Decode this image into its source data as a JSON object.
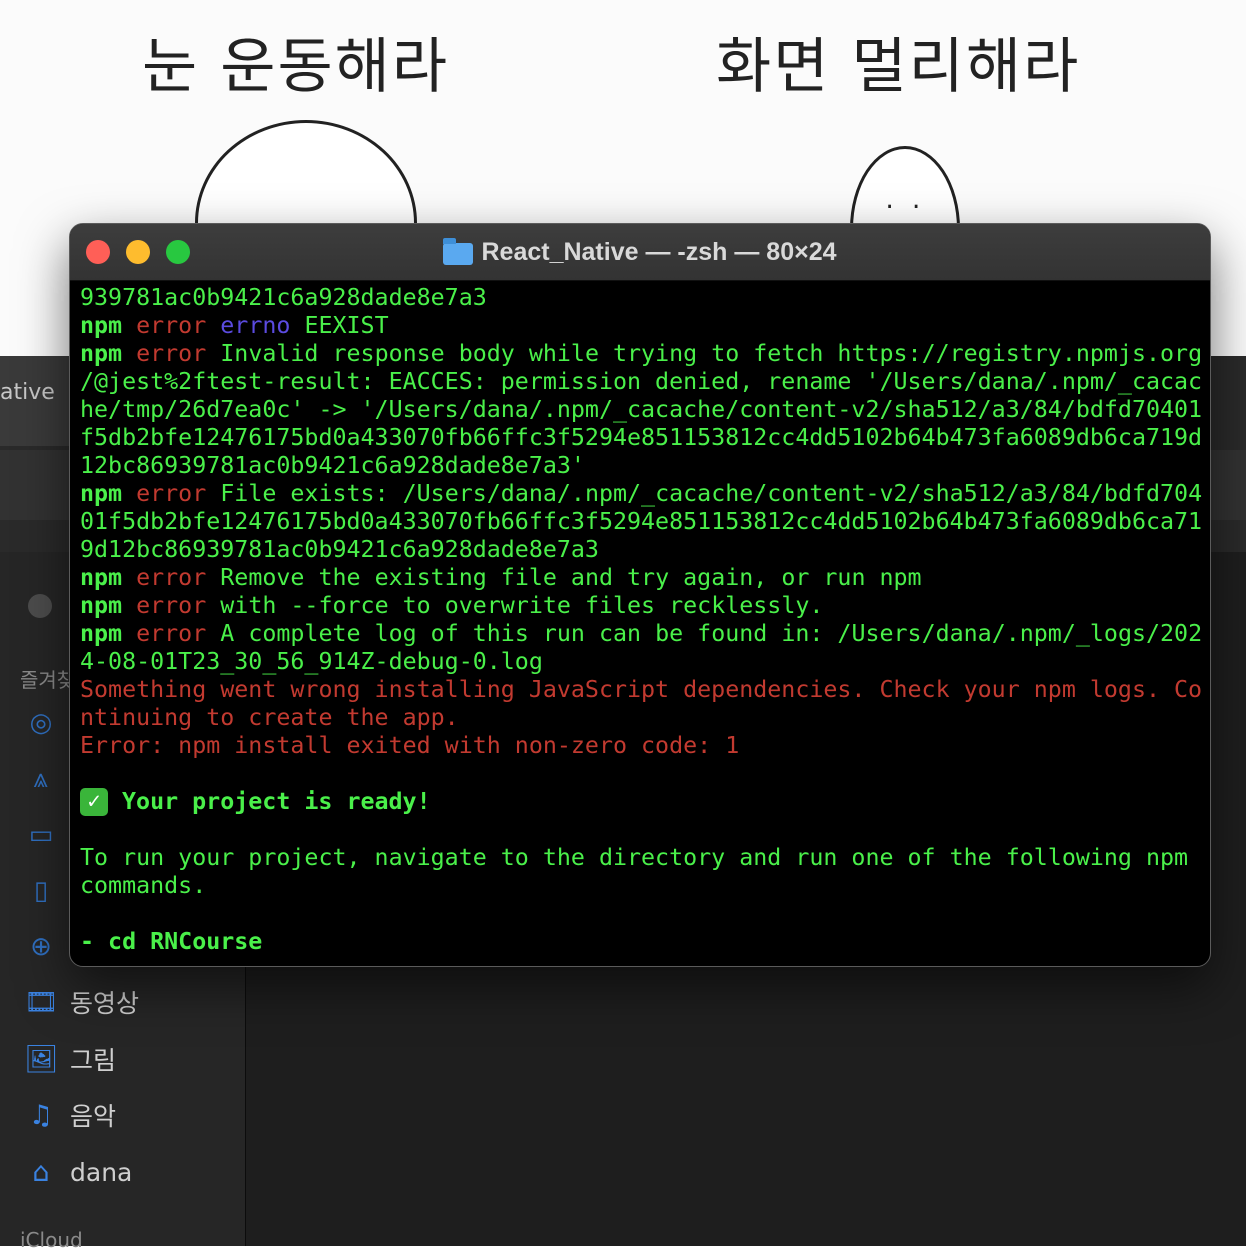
{
  "wallpaper": {
    "caption_left": "눈 운동해라",
    "caption_right": "화면 멀리해라",
    "face": "· ·"
  },
  "finder": {
    "tab_text": "ative",
    "sidebar_heading": "즐겨찾",
    "items": [
      {
        "icon": "🎞",
        "label": "동영상"
      },
      {
        "icon": "🖼",
        "label": "그림"
      },
      {
        "icon": "♫",
        "label": "음악"
      },
      {
        "icon": "⌂",
        "label": "dana"
      }
    ],
    "icloud_heading": "iCloud",
    "right_hint": "?"
  },
  "terminal": {
    "title": "React_Native — -zsh — 80×24",
    "lines": {
      "l1": "939781ac0b9421c6a928dade8e7a3",
      "l2_npm": "npm",
      "l2_err": "error",
      "l2_errno": "errno",
      "l2_text": "EEXIST",
      "l3_npm": "npm",
      "l3_err": "error",
      "l3_text": "Invalid response body while trying to fetch https://registry.npmjs.org",
      "l4": "/@jest%2ftest-result: EACCES: permission denied, rename '/Users/dana/.npm/_cacac",
      "l5": "he/tmp/26d7ea0c' -> '/Users/dana/.npm/_cacache/content-v2/sha512/a3/84/bdfd70401",
      "l6": "f5db2bfe12476175bd0a433070fb66ffc3f5294e851153812cc4dd5102b64b473fa6089db6ca719d",
      "l7": "12bc86939781ac0b9421c6a928dade8e7a3'",
      "l8_npm": "npm",
      "l8_err": "error",
      "l8_text": "File exists: /Users/dana/.npm/_cacache/content-v2/sha512/a3/84/bdfd704",
      "l9": "01f5db2bfe12476175bd0a433070fb66ffc3f5294e851153812cc4dd5102b64b473fa6089db6ca71",
      "l10": "9d12bc86939781ac0b9421c6a928dade8e7a3",
      "l11_npm": "npm",
      "l11_err": "error",
      "l11_text": "Remove the existing file and try again, or run npm",
      "l12_npm": "npm",
      "l12_err": "error",
      "l12_text": "with --force to overwrite files recklessly.",
      "l13_npm": "npm",
      "l13_err": "error",
      "l13_text": "A complete log of this run can be found in: /Users/dana/.npm/_logs/202",
      "l14": "4-08-01T23_30_56_914Z-debug-0.log",
      "l15": "Something went wrong installing JavaScript dependencies. Check your npm logs. Co",
      "l16": "ntinuing to create the app.",
      "l17": "Error: npm install exited with non-zero code: 1",
      "l19_check": "✓",
      "l19_text": "Your project is ready!",
      "l21": "To run your project, navigate to the directory and run one of the following npm",
      "l22": "commands.",
      "l24": "- cd RNCourse"
    }
  }
}
